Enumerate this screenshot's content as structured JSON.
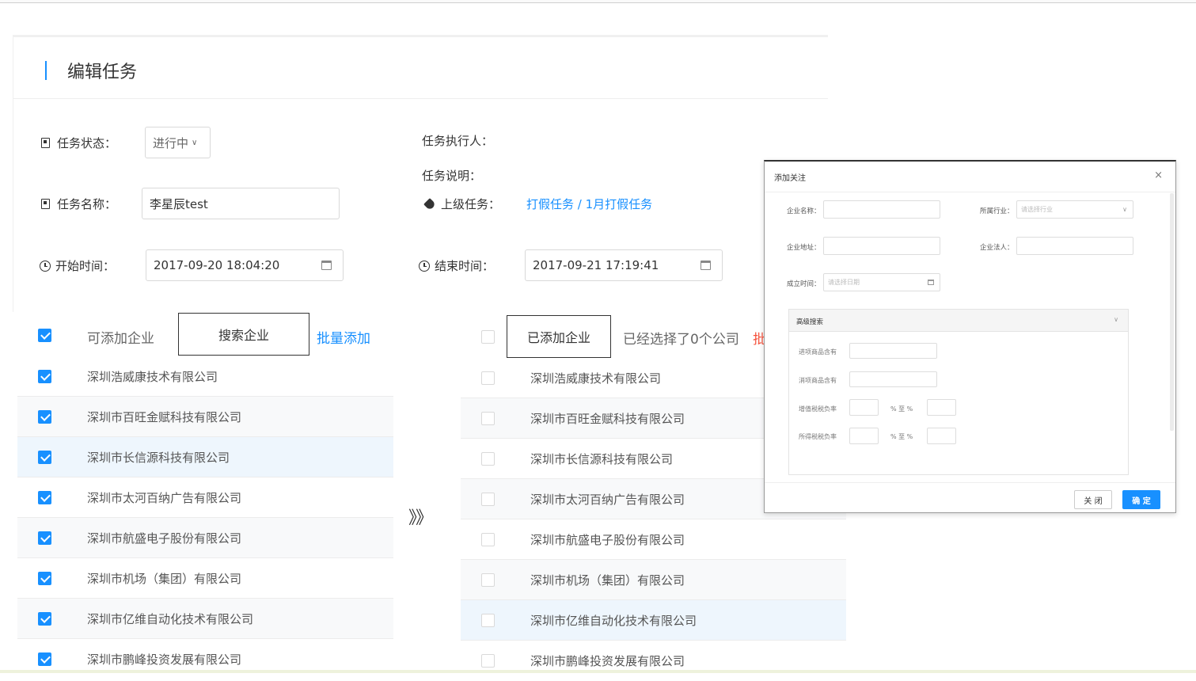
{
  "page": {
    "title": "编辑任务"
  },
  "form": {
    "status_label": "任务状态：",
    "status_value": "进行中",
    "name_label": "任务名称：",
    "name_value": "李星辰test",
    "start_label": "开始时间：",
    "start_value": "2017-09-20 18:04:20",
    "executor_label": "任务执行人：",
    "desc_label": "任务说明：",
    "parent_label": "上级任务：",
    "parent_value": "打假任务 / 1月打假任务",
    "end_label": "结束时间：",
    "end_value": "2017-09-21 17:19:41"
  },
  "left_list": {
    "header_title": "可添加企业",
    "search_button": "搜索企业",
    "batch_add": "批量添加",
    "items": [
      "深圳浩威康技术有限公司",
      "深圳市百旺金赋科技有限公司",
      "深圳市长信源科技有限公司",
      "深圳市太河百纳广告有限公司",
      "深圳市航盛电子股份有限公司",
      "深圳市机场（集团）有限公司",
      "深圳市亿维自动化技术有限公司",
      "深圳市鹏峰投资发展有限公司"
    ]
  },
  "transfer_arrow": "》》",
  "right_list": {
    "added_button": "已添加企业",
    "selected_count": "已经选择了0个公司",
    "batch_partial": "批",
    "items": [
      "深圳浩威康技术有限公司",
      "深圳市百旺金赋科技有限公司",
      "深圳市长信源科技有限公司",
      "深圳市太河百纳广告有限公司",
      "深圳市航盛电子股份有限公司",
      "深圳市机场（集团）有限公司",
      "深圳市亿维自动化技术有限公司",
      "深圳市鹏峰投资发展有限公司"
    ]
  },
  "modal": {
    "title": "添加关注",
    "close_icon": "×",
    "company_name_label": "企业名称：",
    "industry_label": "所属行业：",
    "industry_placeholder": "请选择行业",
    "address_label": "企业地址：",
    "legal_person_label": "企业法人：",
    "founded_label": "成立时间：",
    "founded_placeholder": "请选择日期",
    "advanced_search": "高级搜索",
    "input_goods_label": "进项商品含有",
    "output_goods_label": "消项商品含有",
    "vat_label": "增值税税负率",
    "income_tax_label": "所得税税负率",
    "range_sep": "% 至 %",
    "close_button": "关 闭",
    "ok_button": "确 定"
  }
}
